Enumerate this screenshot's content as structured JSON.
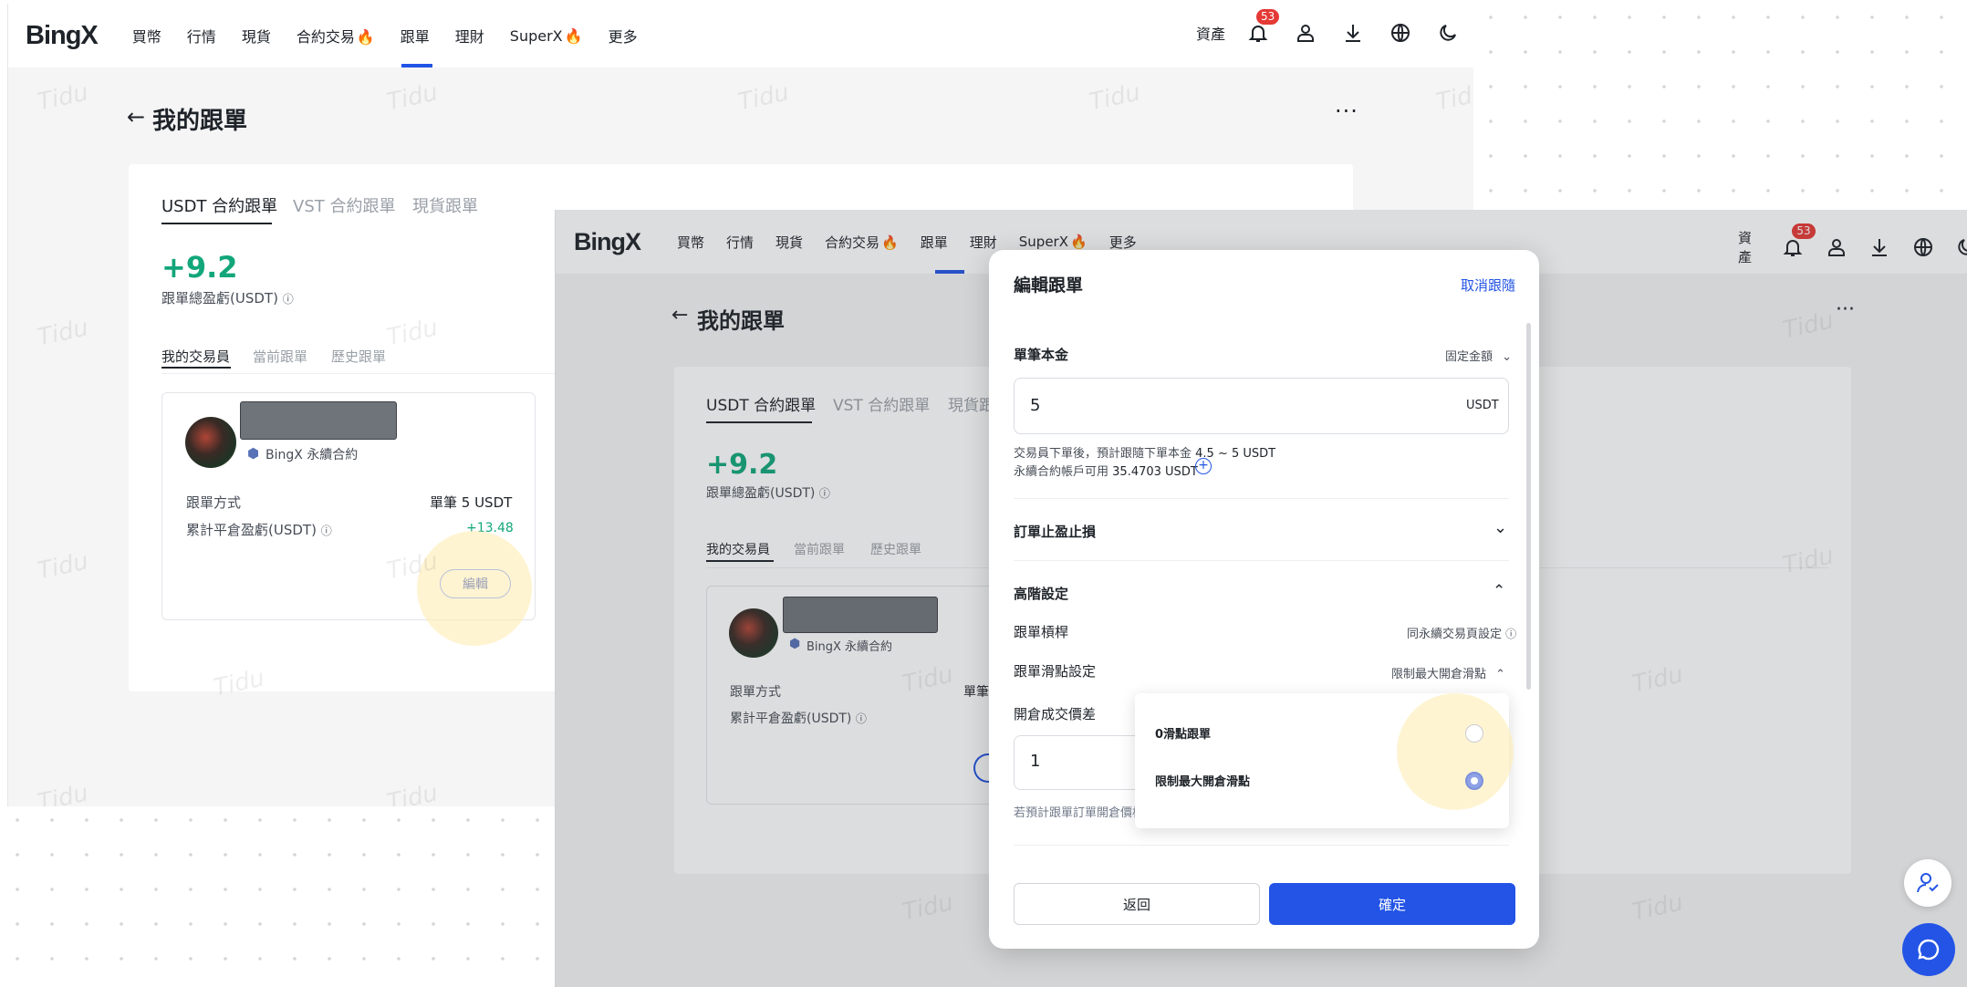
{
  "background": {
    "nav": {
      "logo": "BingX",
      "links": [
        "買幣",
        "行情",
        "現貨",
        "合約交易",
        "跟單",
        "理財",
        "SuperX",
        "更多"
      ],
      "active_link": "跟單",
      "fire_links": [
        "合約交易",
        "SuperX"
      ],
      "assets_label": "資產",
      "notification_count": "53"
    },
    "page_title": "我的跟單",
    "tabs": [
      "USDT 合約跟單",
      "VST 合約跟單",
      "現貨跟單"
    ],
    "total_pnl_value": "+9.2",
    "total_pnl_label": "跟單總盈虧(USDT)",
    "sub_tabs": [
      "我的交易員",
      "當前跟單",
      "歷史跟單"
    ],
    "trader_card": {
      "badge_label": "BingX 永續合約",
      "mode_label": "跟單方式",
      "mode_value": "單筆 5 USDT",
      "pnl_label": "累計平倉盈虧(USDT)",
      "pnl_value": "+13.48",
      "edit_label": "編輯"
    },
    "watermark": "Tidu"
  },
  "modal": {
    "title": "編輯跟單",
    "cancel_follow": "取消跟隨",
    "amount_section": {
      "label": "單筆本金",
      "mode_select": "固定金額",
      "value": "5",
      "unit": "USDT",
      "hint_line1_prefix": "交易員下單後，預計跟隨下單本金",
      "hint_line1_value": "4.5 ~ 5 USDT",
      "hint_line2_prefix": "永續合約帳戶可用",
      "hint_line2_value": "35.4703 USDT"
    },
    "tp_sl_label": "訂單止盈止損",
    "advanced": {
      "label": "高階設定",
      "leverage_label": "跟單槓桿",
      "leverage_value": "同永續交易頁設定",
      "slippage_label": "跟單滑點設定",
      "slippage_value": "限制最大開倉滑點",
      "price_diff_label": "開倉成交價差",
      "price_diff_value": "1",
      "price_diff_hint": "若預計跟單訂單開倉價格"
    },
    "dropdown": {
      "options": [
        "0滑點跟單",
        "限制最大開倉滑點"
      ],
      "selected": "限制最大開倉滑點"
    },
    "back_button": "返回",
    "confirm_button": "確定"
  },
  "colors": {
    "brand_blue": "#2354e6",
    "profit_green": "#12a67a",
    "badge_red": "#e53935"
  },
  "icons": [
    "back-arrow-icon",
    "more-icon",
    "bell-icon",
    "user-icon",
    "download-icon",
    "globe-icon",
    "moon-icon",
    "info-icon",
    "chevron-down-icon",
    "chevron-up-icon",
    "plus-circle-icon",
    "support-agent-icon",
    "chat-icon",
    "fire-icon",
    "verified-badge-icon"
  ]
}
